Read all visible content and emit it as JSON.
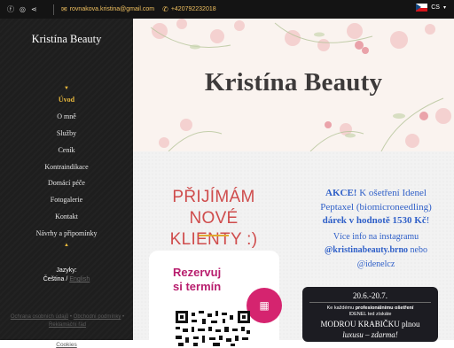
{
  "topbar": {
    "icons": [
      "facebook-icon",
      "instagram-icon",
      "share-icon"
    ],
    "email": "rovnakova.kristina@gmail.com",
    "phone": "+420792232018",
    "language_code": "CS"
  },
  "sidebar": {
    "brand": "Kristína Beauty",
    "nav": [
      {
        "label": "Úvod",
        "active": true
      },
      {
        "label": "O mně"
      },
      {
        "label": "Služby"
      },
      {
        "label": "Ceník"
      },
      {
        "label": "Kontraindikace"
      },
      {
        "label": "Domácí péče"
      },
      {
        "label": "Fotogalerie"
      },
      {
        "label": "Kontakt"
      },
      {
        "label": "Návrhy a připomínky"
      }
    ],
    "languages_label": "Jazyky:",
    "language_current": "Čeština",
    "language_sep": "/",
    "language_other": "English",
    "legal": {
      "privacy": "Ochrana osobních údajů",
      "dot": "•",
      "terms": "Obchodní podmínky",
      "complaints": "Reklamační řád"
    },
    "cookies": "Cookies"
  },
  "hero": {
    "title": "Kristína Beauty",
    "accent_color": "#e8a0a8"
  },
  "content": {
    "headline_line1": "PŘIJÍMÁM NOVÉ",
    "headline_line2": "KLIENTY :)",
    "qr_card": {
      "line1": "Rezervuj",
      "line2": "si termín"
    },
    "promo": {
      "akce": "AKCE!",
      "text1": " K ošetření Idenel",
      "text2": "Peptaxel (biomicroneedling)",
      "gift": "dárek v hodnotě 1530 Kč",
      "gift_end": "!",
      "info1": "Více info na instagramu",
      "handle1": "@kristinabeauty.brno",
      "info2": " nebo",
      "handle2": "@idenelcz"
    },
    "banner": {
      "date": "20.6.-20.7.",
      "sub1_a": "Ke každému ",
      "sub1_b": "profesionálnímu ošetření",
      "sub2": "IDENEL ted získáte",
      "big1": "MODROU KRABIČKU plnou",
      "big2": "luxusu – zdarma!"
    }
  },
  "colors": {
    "gold": "#e8b83c",
    "headline_red": "#cf4c4c",
    "promo_blue": "#3060c8",
    "magenta": "#b81e6e"
  }
}
